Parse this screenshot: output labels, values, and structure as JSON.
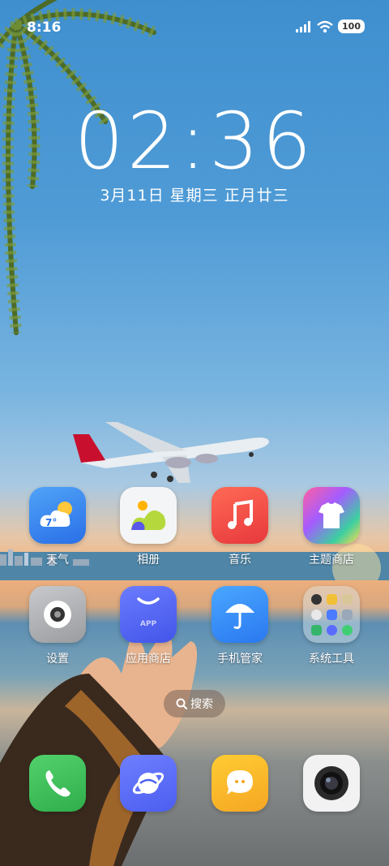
{
  "status_bar": {
    "time": "8:16",
    "battery": "100"
  },
  "lock_clock": {
    "time": "02:36",
    "date": "3月11日 星期三 正月廿三"
  },
  "apps": {
    "weather": {
      "label": "天气",
      "temp": "7°"
    },
    "gallery": {
      "label": "相册"
    },
    "music": {
      "label": "音乐"
    },
    "themes": {
      "label": "主题商店"
    },
    "settings": {
      "label": "设置"
    },
    "app_store": {
      "label": "应用商店",
      "badge": "APP"
    },
    "phone_manager": {
      "label": "手机管家"
    },
    "system_tools": {
      "label": "系统工具"
    }
  },
  "search": {
    "label": "搜索"
  },
  "dock": [
    "phone",
    "browser",
    "messages",
    "camera"
  ]
}
